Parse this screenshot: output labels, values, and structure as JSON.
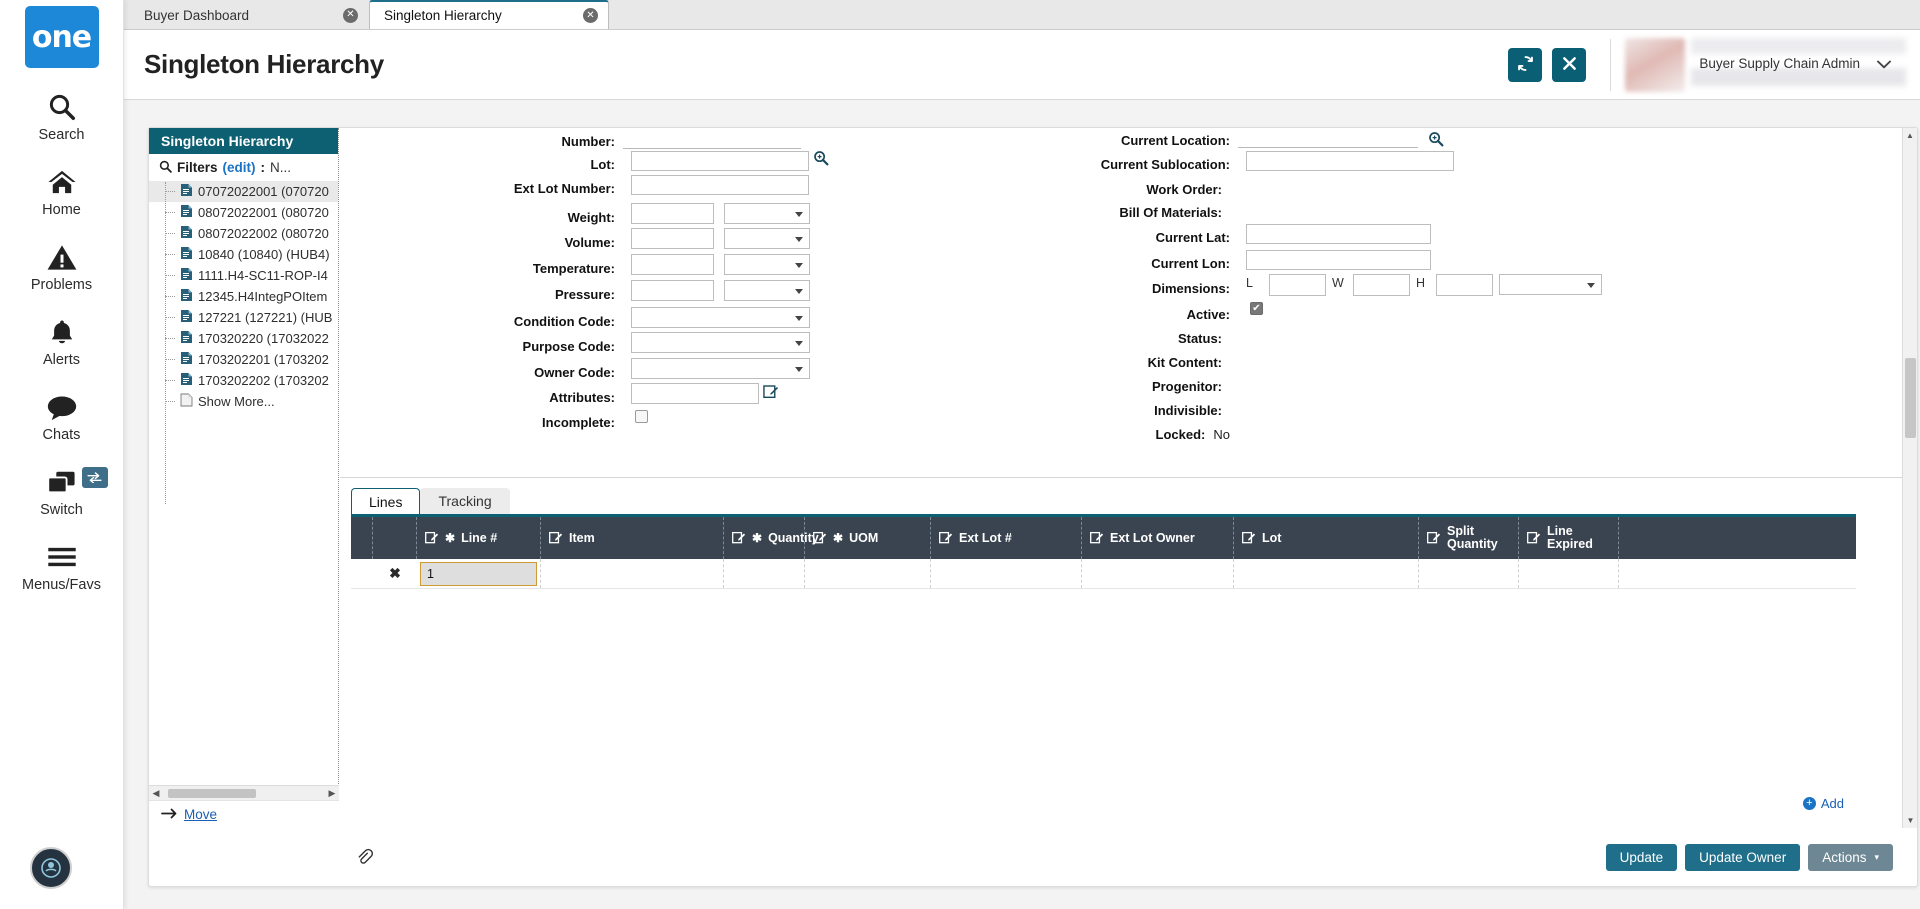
{
  "app": {
    "logo_text": "one"
  },
  "rail": {
    "items": [
      {
        "label": "Search",
        "icon": "search-icon"
      },
      {
        "label": "Home",
        "icon": "home-icon"
      },
      {
        "label": "Problems",
        "icon": "warning-icon"
      },
      {
        "label": "Alerts",
        "icon": "bell-icon"
      },
      {
        "label": "Chats",
        "icon": "chat-icon"
      },
      {
        "label": "Switch",
        "icon": "switch-icon"
      },
      {
        "label": "Menus/Favs",
        "icon": "hamburger-icon"
      }
    ]
  },
  "tabs": [
    {
      "label": "Buyer Dashboard",
      "active": false
    },
    {
      "label": "Singleton Hierarchy",
      "active": true
    }
  ],
  "header": {
    "title": "Singleton Hierarchy",
    "refresh_icon": "refresh-icon",
    "close_icon": "close-icon",
    "user_role": "Buyer Supply Chain Admin",
    "caret_icon": "chevron-down-icon"
  },
  "tree": {
    "title": "Singleton Hierarchy",
    "filters_label": "Filters",
    "filters_edit": "(edit)",
    "filters_colon": ":",
    "filters_value": "N...",
    "items": [
      {
        "label": "07072022001 (070720",
        "selected": true
      },
      {
        "label": "08072022001 (080720",
        "selected": false
      },
      {
        "label": "08072022002 (080720",
        "selected": false
      },
      {
        "label": "10840 (10840) (HUB4)",
        "selected": false
      },
      {
        "label": "1111.H4-SC11-ROP-I4",
        "selected": false
      },
      {
        "label": "12345.H4IntegPOItem",
        "selected": false
      },
      {
        "label": "127221 (127221) (HUB",
        "selected": false
      },
      {
        "label": "170320220 (17032022",
        "selected": false
      },
      {
        "label": "1703202201 (1703202",
        "selected": false
      },
      {
        "label": "1703202202 (1703202",
        "selected": false
      },
      {
        "label": "Show More...",
        "selected": false
      }
    ],
    "move_label": "Move"
  },
  "form": {
    "left": [
      {
        "label": "Number:",
        "type": "text-underline",
        "value": ""
      },
      {
        "label": "Lot:",
        "type": "text-search",
        "value": ""
      },
      {
        "label": "Ext Lot Number:",
        "type": "text",
        "value": ""
      },
      {
        "label": "Weight:",
        "type": "text-select",
        "value": ""
      },
      {
        "label": "Volume:",
        "type": "text-select",
        "value": ""
      },
      {
        "label": "Temperature:",
        "type": "text-select",
        "value": ""
      },
      {
        "label": "Pressure:",
        "type": "text-select",
        "value": ""
      },
      {
        "label": "Condition Code:",
        "type": "select",
        "value": ""
      },
      {
        "label": "Purpose Code:",
        "type": "select",
        "value": ""
      },
      {
        "label": "Owner Code:",
        "type": "select",
        "value": ""
      },
      {
        "label": "Attributes:",
        "type": "text-edit",
        "value": ""
      },
      {
        "label": "Incomplete:",
        "type": "checkbox",
        "value": "",
        "checked": false
      }
    ],
    "right": [
      {
        "label": "Current Location:",
        "type": "text-underline-search",
        "value": ""
      },
      {
        "label": "Current Sublocation:",
        "type": "text",
        "value": ""
      },
      {
        "label": "Work Order:",
        "type": "static",
        "value": ""
      },
      {
        "label": "Bill Of Materials:",
        "type": "static",
        "value": ""
      },
      {
        "label": "Current Lat:",
        "type": "text",
        "value": ""
      },
      {
        "label": "Current Lon:",
        "type": "text",
        "value": ""
      },
      {
        "label": "Dimensions:",
        "type": "dims",
        "value": ""
      },
      {
        "label": "Active:",
        "type": "checkbox",
        "value": "",
        "checked": true
      },
      {
        "label": "Status:",
        "type": "static",
        "value": ""
      },
      {
        "label": "Kit Content:",
        "type": "static",
        "value": ""
      },
      {
        "label": "Progenitor:",
        "type": "static",
        "value": ""
      },
      {
        "label": "Indivisible:",
        "type": "static",
        "value": ""
      },
      {
        "label": "Locked:",
        "type": "static",
        "value": "No"
      }
    ],
    "dims": {
      "l": "L",
      "w": "W",
      "h": "H"
    },
    "checkmark": "✔"
  },
  "lines": {
    "tabs": [
      {
        "label": "Lines",
        "active": true
      },
      {
        "label": "Tracking",
        "active": false
      }
    ],
    "columns": [
      {
        "label": "Line #",
        "edit": true,
        "required": true
      },
      {
        "label": "Item",
        "edit": true,
        "required": false
      },
      {
        "label": "Quantity",
        "edit": true,
        "required": true
      },
      {
        "label": "UOM",
        "edit": true,
        "required": true
      },
      {
        "label": "Ext Lot #",
        "edit": true,
        "required": false
      },
      {
        "label": "Ext Lot Owner",
        "edit": true,
        "required": false
      },
      {
        "label": "Lot",
        "edit": true,
        "required": false
      },
      {
        "label": "Split Quantity",
        "edit": true,
        "required": false
      },
      {
        "label": "Line Expired",
        "edit": true,
        "required": false
      }
    ],
    "rows": [
      {
        "delete_icon": "✖",
        "line_no": "1",
        "item": "",
        "quantity": "",
        "uom": "",
        "ext_lot": "",
        "ext_lot_owner": "",
        "lot": "",
        "split_quantity": "",
        "line_expired": ""
      }
    ],
    "add_label": "Add",
    "required_star": "✱"
  },
  "footer": {
    "update_label": "Update",
    "update_owner_label": "Update Owner",
    "actions_label": "Actions",
    "actions_caret": "▾",
    "attachment_icon": "attachment-icon"
  },
  "colors": {
    "brand_teal": "#0d6072",
    "button_teal": "#1f6f8b",
    "grid_header": "#3a4450",
    "logo_blue": "#1e88d8",
    "link_blue": "#1a5fb4"
  }
}
